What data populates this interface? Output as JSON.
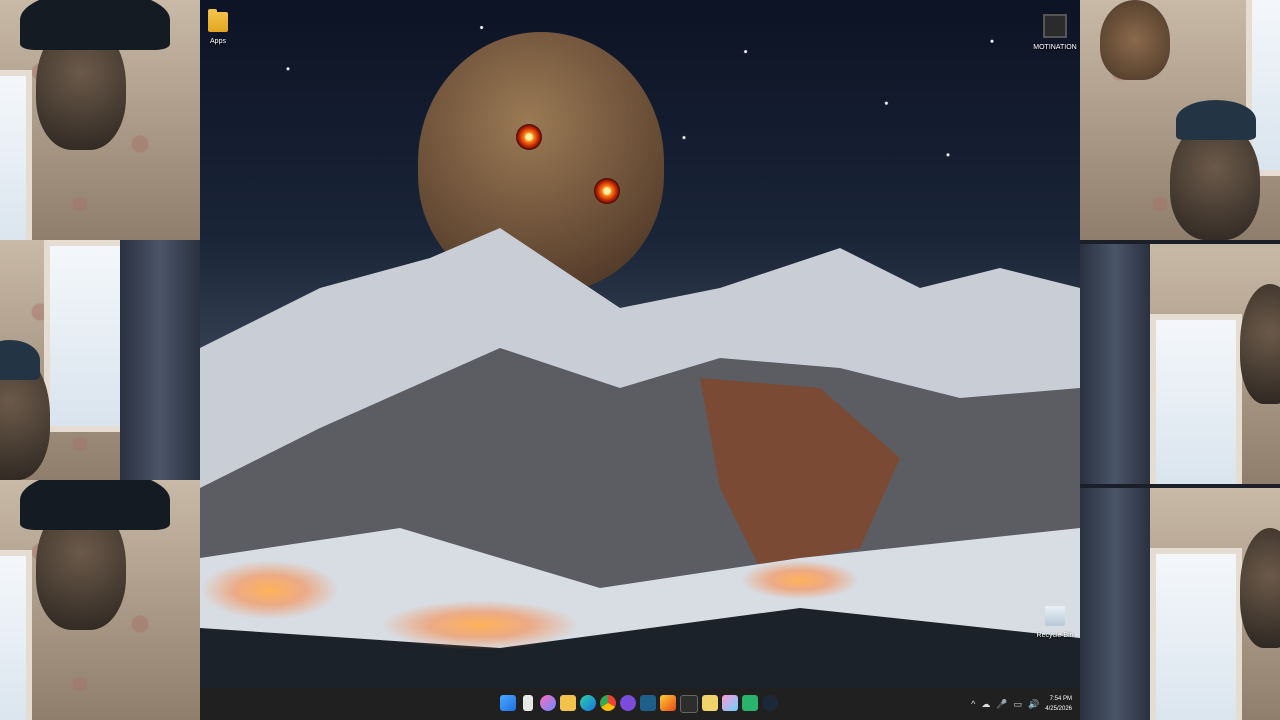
{
  "desktop": {
    "icons": [
      {
        "label": "Apps",
        "icon": "folder-icon"
      },
      {
        "label": "MOTINATION",
        "icon": "video-file-icon"
      },
      {
        "label": "Recycle Bin",
        "icon": "recycle-bin-icon"
      }
    ]
  },
  "taskbar": {
    "pinned": [
      {
        "icon": "start-icon"
      },
      {
        "icon": "task-view-icon"
      },
      {
        "icon": "copilot-icon"
      },
      {
        "icon": "file-explorer-icon"
      },
      {
        "icon": "edge-icon"
      },
      {
        "icon": "chrome-icon"
      },
      {
        "icon": "app-purple-icon"
      },
      {
        "icon": "app-fish-icon"
      },
      {
        "icon": "app-paint-icon"
      },
      {
        "icon": "terminal-icon"
      },
      {
        "icon": "app-duck-icon"
      },
      {
        "icon": "app-sparkle-icon"
      },
      {
        "icon": "app-green-icon"
      },
      {
        "icon": "steam-icon"
      }
    ],
    "tray": {
      "chevron": "^",
      "time": "7:54 PM",
      "date": "4/25/2026"
    }
  },
  "colors": {
    "taskbar_bg": "#202020",
    "start_blue": "#2b8cff",
    "moon_eye": "#ff7a10"
  }
}
